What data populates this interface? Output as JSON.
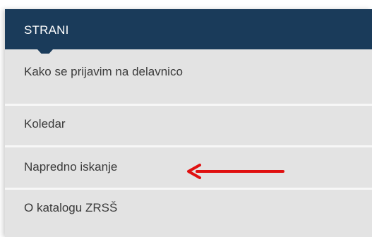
{
  "menu": {
    "title": "STRANI",
    "items": [
      {
        "label": "Kako se prijavim na delavnico"
      },
      {
        "label": "Koledar"
      },
      {
        "label": "Napredno iskanje"
      },
      {
        "label": "O katalogu ZRSŠ"
      }
    ]
  },
  "colors": {
    "header_bg": "#1a3b5a",
    "item_bg": "#e3e3e3",
    "divider": "#f7f7f7",
    "annotation_arrow": "#e01010"
  },
  "annotation": {
    "icon": "red-arrow-icon",
    "points_to_item": 2
  }
}
